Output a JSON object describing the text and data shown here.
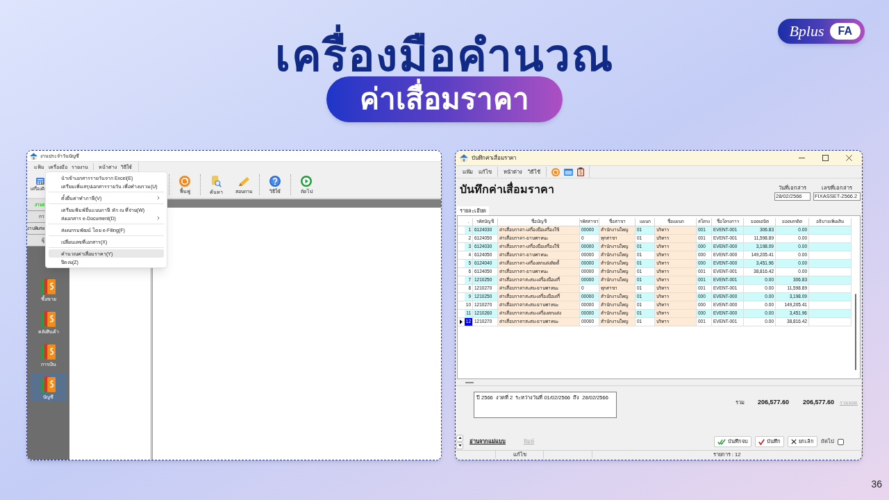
{
  "slide": {
    "title": "เครื่องมือคำนวณ",
    "subtitle": "ค่าเสื่อมราคา",
    "logo": {
      "script": "Bplus",
      "tag": "FA"
    },
    "page_number": "36"
  },
  "left_window": {
    "title": "งานประจำวันบัญชี",
    "menu_bar": [
      {
        "items": [
          "แฟ้ม",
          "เครื่องมือ",
          "รายงาน"
        ]
      },
      {
        "items": [
          "หน้าต่าง",
          "วิธีใช้"
        ]
      }
    ],
    "toolbar": [
      {
        "items": [
          "เครื่องคิ"
        ]
      },
      {
        "items": [
          "ฟื้นฟู"
        ]
      },
      {
        "items": [
          "ค้นหา",
          "สอบถาม"
        ]
      },
      {
        "items": [
          "วิธีใช้"
        ]
      },
      {
        "items": [
          "ถัดไป"
        ]
      }
    ],
    "nav_buttons": [
      {
        "label": "งานร",
        "selected": true
      },
      {
        "label": "กา",
        "selected": false
      },
      {
        "label": "งานพิเศษ",
        "selected": false
      },
      {
        "label": "ผู้",
        "selected": false
      }
    ],
    "modules": [
      {
        "label": "ซื้อขาย",
        "selected": false
      },
      {
        "label": "คลังสินค้า",
        "selected": false
      },
      {
        "label": "การเงิน",
        "selected": false
      },
      {
        "label": "บัญชี",
        "selected": true
      }
    ],
    "dropdown_menu": [
      {
        "items": [
          {
            "label": "นำเข้าเอกสารรายวันจาก Excel(E)",
            "submenu": false,
            "selected": false
          },
          {
            "label": "เตรียมเพิ่มสรุปเอกสารรายวัน เพื่อทำงบรวม(U)",
            "submenu": false,
            "selected": false
          }
        ]
      },
      {
        "items": [
          {
            "label": "ตั้งยื่นค่าทำภาษี(V)",
            "submenu": true,
            "selected": false
          }
        ]
      },
      {
        "items": [
          {
            "label": "เตรียมพิมพ์ยื่นแบบภาษี หัก ณ ที่จ่าย(W)",
            "submenu": false,
            "selected": false
          },
          {
            "label": "ส่งเอกสาร e-Document(D)",
            "submenu": true,
            "selected": false
          }
        ]
      },
      {
        "items": [
          {
            "label": "ส่งงบกรมพัฒน์ โดย e-Filing(F)",
            "submenu": false,
            "selected": false
          }
        ]
      },
      {
        "items": [
          {
            "label": "เปลี่ยนเลขที่เอกสาร(X)",
            "submenu": false,
            "selected": false
          }
        ]
      },
      {
        "items": [
          {
            "label": "คำนวณค่าเสื่อมราคา(Y)",
            "submenu": false,
            "selected": true
          },
          {
            "label": "ปิดงบ(Z)",
            "submenu": false,
            "selected": false
          }
        ]
      }
    ]
  },
  "right_window": {
    "title": "บันทึกค่าเสื่อมราคา",
    "menu_bar": [
      {
        "items": [
          "แฟ้ม",
          "แก้ไข"
        ]
      },
      {
        "items": [
          "หน้าต่าง",
          "วิธีใช้"
        ]
      }
    ],
    "heading": "บันทึกค่าเสื่อมราคา",
    "fields": [
      {
        "label": "วันที่เอกสาร",
        "value": "28/02/2566"
      },
      {
        "label": "เลขที่เอกสาร",
        "value": "FIXASSET-2566.2"
      }
    ],
    "tabs": [
      {
        "label": "รายละเอียด",
        "selected": true
      }
    ],
    "table": {
      "columns": [
        {
          "label": ".",
          "readonly": false
        },
        {
          "label": "รหัสบัญชี",
          "readonly": false
        },
        {
          "label": "ชื่อบัญชี",
          "readonly": true
        },
        {
          "label": "รหัสสาขา",
          "readonly": false
        },
        {
          "label": "ชื่อสาขา",
          "readonly": true
        },
        {
          "label": "แผนก",
          "readonly": false
        },
        {
          "label": "ชื่อแผนก",
          "readonly": true
        },
        {
          "label": "สโครง",
          "readonly": false
        },
        {
          "label": "ชื่อโครงการ",
          "readonly": false
        },
        {
          "label": "ยอดเดบิต",
          "readonly": false
        },
        {
          "label": "ยอดเครดิต",
          "readonly": false
        },
        {
          "label": "อธิบายเพิ่มเติม",
          "readonly": false
        }
      ],
      "rows": [
        {
          "cells": [
            "1",
            "6124030",
            "ค่าเสื่อมราคา-เครื่องมือเครื่องใช้",
            "00000",
            "สำนักงานใหญ",
            "01",
            "บริหาร",
            "001",
            "EVENT-001",
            "306.83",
            "0.00"
          ],
          "selected": false
        },
        {
          "cells": [
            "2",
            "6124050",
            "ค่าเสื่อมราคา-ยานพาหนะ",
            "0",
            "ทุกสาขา",
            "01",
            "บริหาร",
            "001",
            "EVENT-001",
            "11,598.89",
            "0.00"
          ],
          "selected": false
        },
        {
          "cells": [
            "3",
            "6124030",
            "ค่าเสื่อมราคา-เครื่องมือเครื่องใช้",
            "00000",
            "สำนักงานใหญ",
            "01",
            "บริหาร",
            "000",
            "EVENT-000",
            "3,198.09",
            "0.00"
          ],
          "selected": false
        },
        {
          "cells": [
            "4",
            "6124050",
            "ค่าเสื่อมราคา-ยานพาหนะ",
            "00000",
            "สำนักงานใหญ",
            "01",
            "บริหาร",
            "000",
            "EVENT-000",
            "149,205.41",
            "0.00"
          ],
          "selected": false
        },
        {
          "cells": [
            "5",
            "6124040",
            "ค่าเสื่อมราคา-เครื่องตกแต่งติดตั้",
            "00000",
            "สำนักงานใหญ",
            "01",
            "บริหาร",
            "000",
            "EVENT-000",
            "3,451.96",
            "0.00"
          ],
          "selected": false
        },
        {
          "cells": [
            "6",
            "6124050",
            "ค่าเสื่อมราคา-ยานพาหนะ",
            "00000",
            "สำนักงานใหญ",
            "01",
            "บริหาร",
            "001",
            "EVENT-001",
            "38,816.42",
            "0.00"
          ],
          "selected": false
        },
        {
          "cells": [
            "7",
            "1210250",
            "ค่าเสื่อมราคาสะสม-เครื่องมือเครื่",
            "00000",
            "สำนักงานใหญ",
            "01",
            "บริหาร",
            "001",
            "EVENT-001",
            "0.00",
            "306.83"
          ],
          "selected": false
        },
        {
          "cells": [
            "8",
            "1210270",
            "ค่าเสื่อมราคาสะสม-ยานพาหนะ",
            "0",
            "ทุกสาขา",
            "01",
            "บริหาร",
            "001",
            "EVENT-001",
            "0.00",
            "11,598.89"
          ],
          "selected": false
        },
        {
          "cells": [
            "9",
            "1210250",
            "ค่าเสื่อมราคาสะสม-เครื่องมือเครื่",
            "00000",
            "สำนักงานใหญ",
            "01",
            "บริหาร",
            "000",
            "EVENT-000",
            "0.00",
            "3,198.09"
          ],
          "selected": false
        },
        {
          "cells": [
            "10",
            "1210270",
            "ค่าเสื่อมราคาสะสม-ยานพาหนะ",
            "00000",
            "สำนักงานใหญ",
            "01",
            "บริหาร",
            "000",
            "EVENT-000",
            "0.00",
            "149,205.41"
          ],
          "selected": false
        },
        {
          "cells": [
            "11",
            "1210260",
            "ค่าเสื่อมราคาสะสม-เครื่องตกแต่ง",
            "00000",
            "สำนักงานใหญ",
            "01",
            "บริหาร",
            "000",
            "EVENT-000",
            "0.00",
            "3,451.96"
          ],
          "selected": false
        },
        {
          "cells": [
            "12",
            "1210270",
            "ค่าเสื่อมราคาสะสม-ยานพาหนะ",
            "00000",
            "สำนักงานใหญ",
            "01",
            "บริหาร",
            "001",
            "EVENT-001",
            "0.00",
            "38,816.42"
          ],
          "selected": true
        }
      ]
    },
    "description": "ปี 2566  งวดที่ 2  ระหว่างวันที่ 01/02/2566  ถึง  28/02/2566",
    "totals": {
      "label": "รวม",
      "debit": "206,577.60",
      "credit": "206,577.60",
      "action": {
        "label": "รวมยอด",
        "disabled": true
      }
    },
    "links": [
      {
        "label": "อ่านจากแม่แบบ",
        "disabled": false
      },
      {
        "label": "พิมพ์",
        "disabled": true
      }
    ],
    "buttons": [
      "บันทึกจบ",
      "บันทึก",
      "ยกเลิก"
    ],
    "next_option": {
      "label": "ถัดไป",
      "checked": false
    },
    "status_bar": [
      "แก้ไข",
      "รายการ : 12"
    ]
  }
}
